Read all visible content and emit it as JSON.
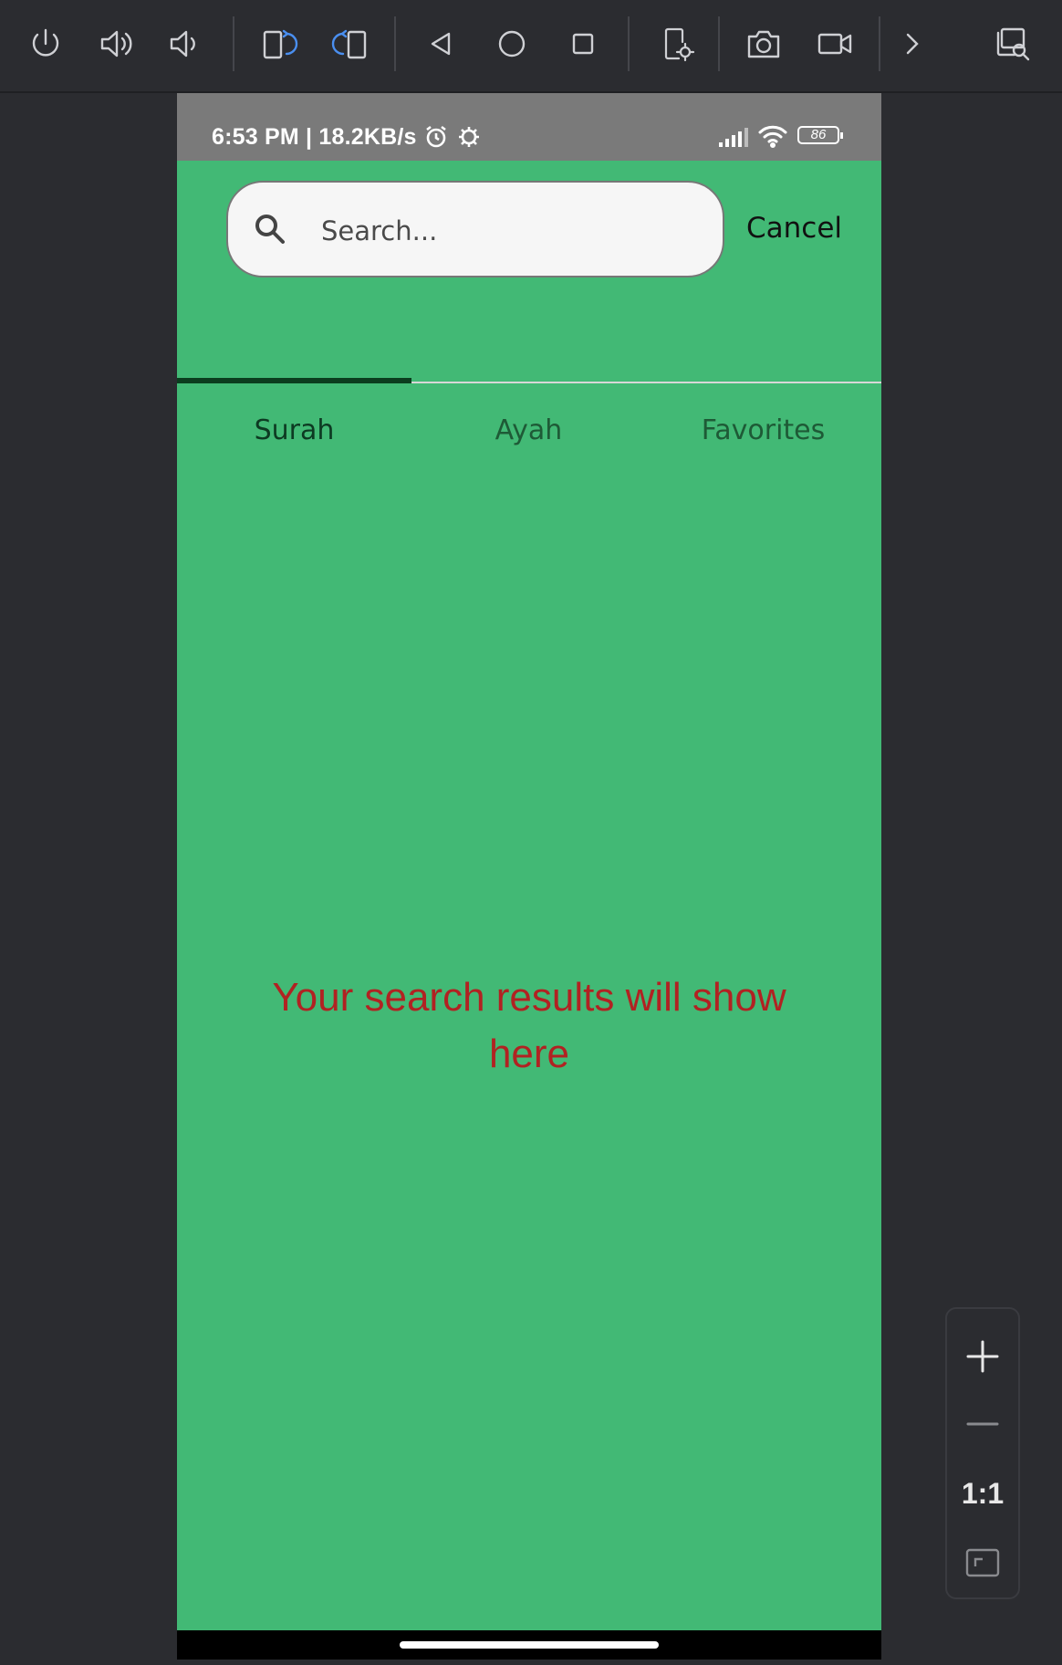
{
  "toolbar": {
    "buttons": [
      {
        "name": "power-icon"
      },
      {
        "name": "volume-up-icon"
      },
      {
        "name": "volume-down-icon"
      },
      {
        "name": "rotate-left-icon"
      },
      {
        "name": "rotate-right-icon"
      },
      {
        "name": "back-icon"
      },
      {
        "name": "home-icon"
      },
      {
        "name": "overview-icon"
      },
      {
        "name": "device-settings-icon"
      },
      {
        "name": "camera-icon"
      },
      {
        "name": "video-record-icon"
      },
      {
        "name": "chevron-right-icon"
      },
      {
        "name": "window-search-icon"
      }
    ]
  },
  "statusbar": {
    "time": "6:53 PM | 18.2KB/s",
    "battery": "86"
  },
  "search": {
    "placeholder": "Search...",
    "value": "",
    "cancel_label": "Cancel"
  },
  "tabs": [
    {
      "label": "Surah",
      "active": true
    },
    {
      "label": "Ayah",
      "active": false
    },
    {
      "label": "Favorites",
      "active": false
    }
  ],
  "main": {
    "empty_message": "Your search results will show here"
  },
  "zoom": {
    "reset_label": "1:1"
  },
  "colors": {
    "app_background": "#42b975",
    "message_red": "#b12222",
    "statusbar_gray": "#7a7a7a",
    "tab_indicator": "#0b3d1e"
  }
}
